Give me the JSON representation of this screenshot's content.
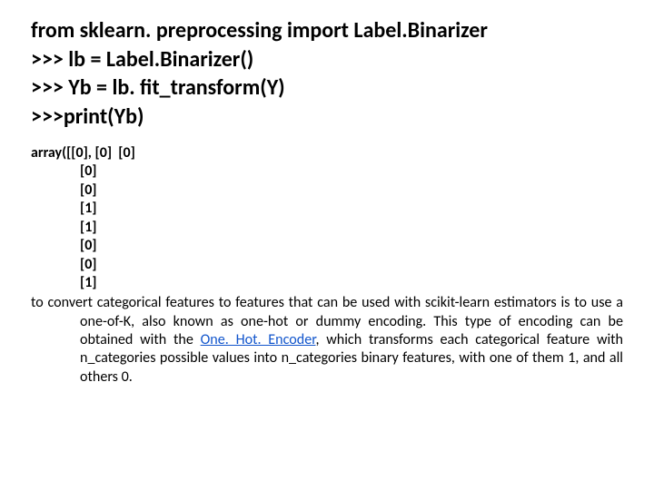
{
  "code": {
    "l1": "from sklearn. preprocessing import Label.Binarizer",
    "l2": ">>> lb = Label.Binarizer()",
    "l3": ">>> Yb = lb. fit_transform(Y)",
    "l4": ">>>print(Yb)"
  },
  "output": {
    "first": "array([[0], [0]  [0]",
    "r1": "[0]",
    "r2": "[0]",
    "r3": "[1]",
    "r4": "[1]",
    "r5": "[0]",
    "r6": "[0]",
    "r7": "[1]"
  },
  "explain": {
    "pre": "to convert categorical features to features that can be used with scikit-learn estimators is to use a one-of-K, also known as one-hot or dummy encoding. This type of encoding can be obtained with the ",
    "link": "One. Hot. Encoder",
    "post": ", which transforms each categorical feature with n_categories possible values into n_categories binary features, with one of them 1, and all others 0."
  }
}
